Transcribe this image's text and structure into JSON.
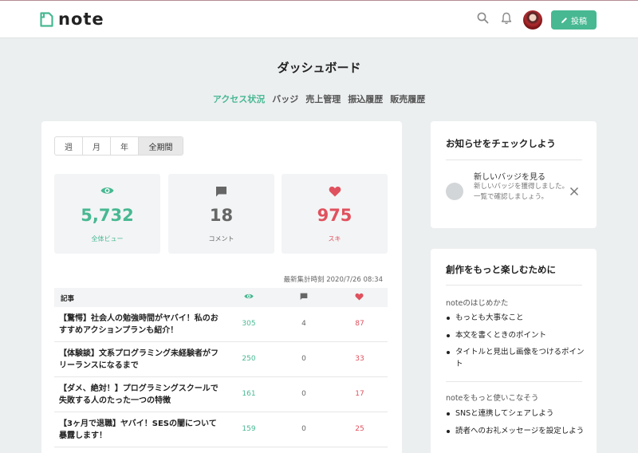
{
  "header": {
    "logo_text": "note",
    "post_button_label": "投稿"
  },
  "page": {
    "title": "ダッシュボード"
  },
  "tabs": [
    {
      "label": "アクセス状況",
      "active": true
    },
    {
      "label": "バッジ",
      "active": false
    },
    {
      "label": "売上管理",
      "active": false
    },
    {
      "label": "振込履歴",
      "active": false
    },
    {
      "label": "販売履歴",
      "active": false
    }
  ],
  "period": {
    "options": [
      "週",
      "月",
      "年",
      "全期間"
    ],
    "selected": "全期間"
  },
  "stats": {
    "views": {
      "value": "5,732",
      "label": "全体ビュー",
      "icon": "eye-icon",
      "color": "#47b892"
    },
    "comments": {
      "value": "18",
      "label": "コメント",
      "icon": "comment-icon",
      "color": "#666666"
    },
    "likes": {
      "value": "975",
      "label": "スキ",
      "icon": "heart-icon",
      "color": "#e0515e"
    }
  },
  "table": {
    "timestamp": "最新集計時刻 2020/7/26 08:34",
    "header_article": "記事",
    "rows": [
      {
        "title": "【驚愕】社会人の勉強時間がヤバイ！私のおすすめアクションプランも紹介！",
        "views": "305",
        "comments": "4",
        "likes": "87"
      },
      {
        "title": "【体験談】文系プログラミング未経験者がフリーランスになるまで",
        "views": "250",
        "comments": "0",
        "likes": "33"
      },
      {
        "title": "【ダメ、絶対！】プログラミングスクールで失敗する人のたった一つの特徴",
        "views": "161",
        "comments": "0",
        "likes": "17"
      },
      {
        "title": "【3ヶ月で退職】ヤバイ！SESの闇について暴露します！",
        "views": "159",
        "comments": "0",
        "likes": "25"
      }
    ]
  },
  "notice": {
    "heading": "お知らせをチェックしよう",
    "title": "新しいバッジを見る",
    "description": "新しいバッジを獲得しました。一覧で確認しましょう。"
  },
  "tips": {
    "heading": "創作をもっと楽しむために",
    "sections": [
      {
        "title": "noteのはじめかた",
        "items": [
          "もっとも大事なこと",
          "本文を書くときのポイント",
          "タイトルと見出し画像をつけるポイント"
        ]
      },
      {
        "title": "noteをもっと使いこなそう",
        "items": [
          "SNSと連携してシェアしよう",
          "読者へのお礼メッセージを設定しよう"
        ]
      }
    ]
  },
  "colors": {
    "accent": "#47b892",
    "like": "#e0515e",
    "background": "#eceff0"
  }
}
